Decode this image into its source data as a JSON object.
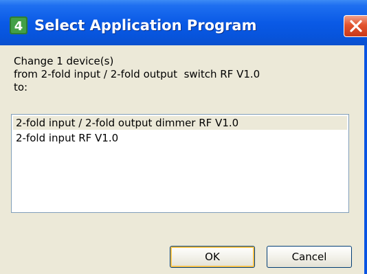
{
  "window": {
    "title": "Select Application Program",
    "icon": "ets-app-icon",
    "accent": "#0a54e3",
    "close_icon": "close-icon"
  },
  "message": {
    "line1": "Change 1 device(s)",
    "line2": "from 2-fold input / 2-fold output  switch RF V1.0",
    "line3": "to:"
  },
  "list": {
    "items": [
      {
        "label": "2-fold input / 2-fold output dimmer RF V1.0",
        "selected": true
      },
      {
        "label": "2-fold input RF V1.0",
        "selected": false
      }
    ]
  },
  "buttons": {
    "ok_label": "OK",
    "cancel_label": "Cancel"
  }
}
